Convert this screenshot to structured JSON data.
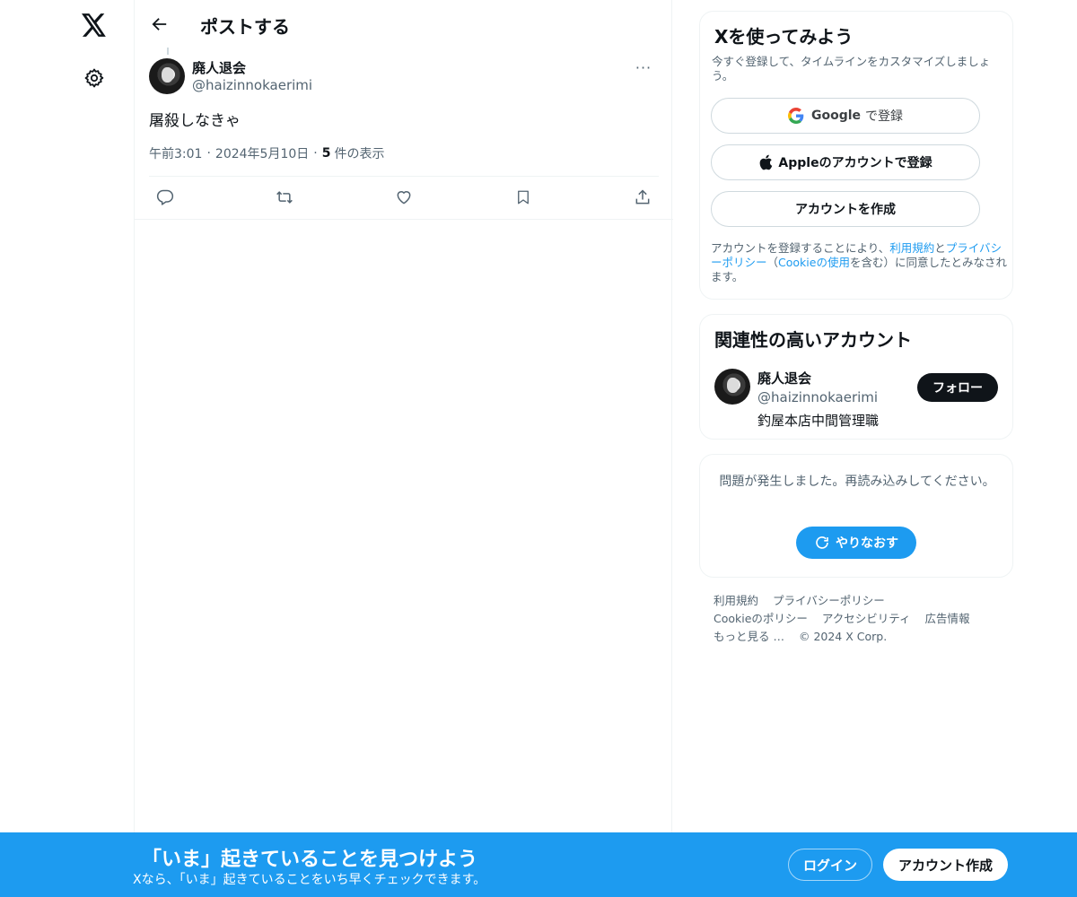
{
  "header": {
    "title": "ポストする"
  },
  "post": {
    "author_name": "廃人退会",
    "author_handle": "@haizinnokaerimi",
    "text": "屠殺しなきゃ",
    "time": "午前3:01",
    "date": "2024年5月10日",
    "views_count": "5",
    "views_label": "件の表示",
    "more_label": "···"
  },
  "signup_card": {
    "title": "Xを使ってみよう",
    "subtitle": "今すぐ登録して、タイムラインをカスタマイズしましょう。",
    "google_brand": "Google",
    "google_suffix": "で登録",
    "apple_label": "Appleのアカウントで登録",
    "create_label": "アカウントを作成",
    "terms_prefix": "アカウントを登録することにより、",
    "terms_link": "利用規約",
    "terms_and": "と",
    "privacy_link": "プライバシーポリシー",
    "terms_open": "（",
    "cookie_link": "Cookieの使用",
    "terms_suffix": "を含む）に同意したとみなされます。"
  },
  "related": {
    "title": "関連性の高いアカウント",
    "name": "廃人退会",
    "handle": "@haizinnokaerimi",
    "bio": "釣屋本店中間管理職",
    "follow_label": "フォロー"
  },
  "error_card": {
    "message": "問題が発生しました。再読み込みしてください。",
    "retry_label": "やりなおす"
  },
  "footer": {
    "links": [
      "利用規約",
      "プライバシーポリシー",
      "Cookieのポリシー",
      "アクセシビリティ",
      "広告情報",
      "もっと見る …"
    ],
    "copyright": "© 2024 X Corp."
  },
  "bottom_bar": {
    "title": "「いま」起きていることを見つけよう",
    "subtitle": "Xなら、「いま」起きていることをいち早くチェックできます。",
    "login_label": "ログイン",
    "signup_label": "アカウント作成"
  },
  "colors": {
    "accent": "#1d9bf0",
    "text": "#0f1419",
    "muted": "#536471",
    "border": "#eff3f4"
  },
  "icons": [
    "x-logo-icon",
    "gear-icon",
    "back-arrow-icon",
    "reply-icon",
    "repost-icon",
    "like-icon",
    "bookmark-icon",
    "share-icon",
    "google-icon",
    "apple-icon",
    "refresh-icon"
  ]
}
